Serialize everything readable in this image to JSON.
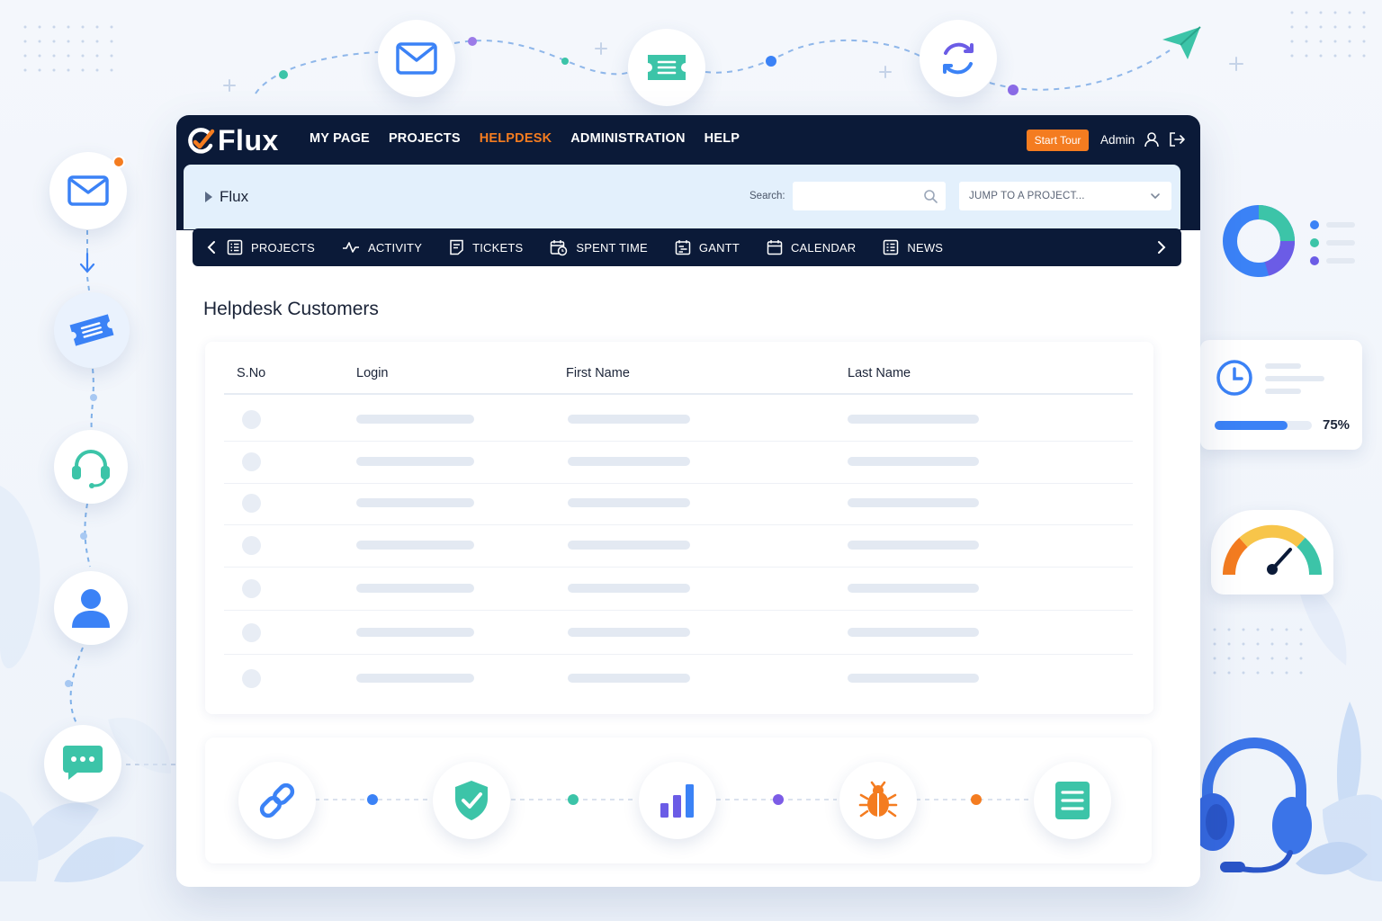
{
  "app": {
    "name": "Flux",
    "nav": [
      "MY PAGE",
      "PROJECTS",
      "HELPDESK",
      "ADMINISTRATION",
      "HELP"
    ],
    "active_nav": "HELPDESK",
    "start_tour_label": "Start Tour",
    "user_label": "Admin"
  },
  "subheader": {
    "breadcrumb": "Flux",
    "search_label": "Search:",
    "search_value": "",
    "jump_placeholder": "JUMP TO A PROJECT..."
  },
  "project_tabs": [
    "PROJECTS",
    "ACTIVITY",
    "TICKETS",
    "SPENT TIME",
    "GANTT",
    "CALENDAR",
    "NEWS"
  ],
  "page": {
    "title": "Helpdesk Customers",
    "columns": [
      "S.No",
      "Login",
      "First Name",
      "Last Name"
    ]
  },
  "progress_widget": {
    "percent_label": "75%",
    "value": 0.75
  },
  "colors": {
    "navy": "#0b1a38",
    "accent_orange": "#f47c20",
    "blue": "#3b82f6",
    "teal": "#3cc4a8",
    "purple": "#7c5ce6"
  },
  "icons": [
    "mail-icon",
    "ticket-icon",
    "sync-icon",
    "paper-plane-icon",
    "headset-icon",
    "user-icon",
    "chat-icon",
    "link-icon",
    "shield-check-icon",
    "bar-chart-icon",
    "bug-icon",
    "document-icon",
    "clock-icon",
    "gauge-icon",
    "donut-chart-icon"
  ]
}
